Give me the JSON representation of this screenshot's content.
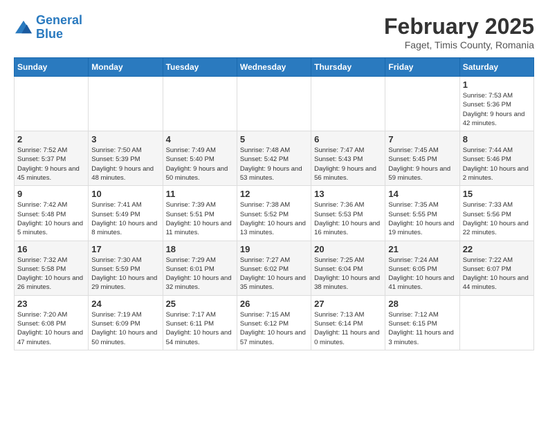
{
  "logo": {
    "line1": "General",
    "line2": "Blue"
  },
  "header": {
    "month": "February 2025",
    "location": "Faget, Timis County, Romania"
  },
  "weekdays": [
    "Sunday",
    "Monday",
    "Tuesday",
    "Wednesday",
    "Thursday",
    "Friday",
    "Saturday"
  ],
  "weeks": [
    [
      {
        "day": "",
        "info": ""
      },
      {
        "day": "",
        "info": ""
      },
      {
        "day": "",
        "info": ""
      },
      {
        "day": "",
        "info": ""
      },
      {
        "day": "",
        "info": ""
      },
      {
        "day": "",
        "info": ""
      },
      {
        "day": "1",
        "info": "Sunrise: 7:53 AM\nSunset: 5:36 PM\nDaylight: 9 hours and 42 minutes."
      }
    ],
    [
      {
        "day": "2",
        "info": "Sunrise: 7:52 AM\nSunset: 5:37 PM\nDaylight: 9 hours and 45 minutes."
      },
      {
        "day": "3",
        "info": "Sunrise: 7:50 AM\nSunset: 5:39 PM\nDaylight: 9 hours and 48 minutes."
      },
      {
        "day": "4",
        "info": "Sunrise: 7:49 AM\nSunset: 5:40 PM\nDaylight: 9 hours and 50 minutes."
      },
      {
        "day": "5",
        "info": "Sunrise: 7:48 AM\nSunset: 5:42 PM\nDaylight: 9 hours and 53 minutes."
      },
      {
        "day": "6",
        "info": "Sunrise: 7:47 AM\nSunset: 5:43 PM\nDaylight: 9 hours and 56 minutes."
      },
      {
        "day": "7",
        "info": "Sunrise: 7:45 AM\nSunset: 5:45 PM\nDaylight: 9 hours and 59 minutes."
      },
      {
        "day": "8",
        "info": "Sunrise: 7:44 AM\nSunset: 5:46 PM\nDaylight: 10 hours and 2 minutes."
      }
    ],
    [
      {
        "day": "9",
        "info": "Sunrise: 7:42 AM\nSunset: 5:48 PM\nDaylight: 10 hours and 5 minutes."
      },
      {
        "day": "10",
        "info": "Sunrise: 7:41 AM\nSunset: 5:49 PM\nDaylight: 10 hours and 8 minutes."
      },
      {
        "day": "11",
        "info": "Sunrise: 7:39 AM\nSunset: 5:51 PM\nDaylight: 10 hours and 11 minutes."
      },
      {
        "day": "12",
        "info": "Sunrise: 7:38 AM\nSunset: 5:52 PM\nDaylight: 10 hours and 13 minutes."
      },
      {
        "day": "13",
        "info": "Sunrise: 7:36 AM\nSunset: 5:53 PM\nDaylight: 10 hours and 16 minutes."
      },
      {
        "day": "14",
        "info": "Sunrise: 7:35 AM\nSunset: 5:55 PM\nDaylight: 10 hours and 19 minutes."
      },
      {
        "day": "15",
        "info": "Sunrise: 7:33 AM\nSunset: 5:56 PM\nDaylight: 10 hours and 22 minutes."
      }
    ],
    [
      {
        "day": "16",
        "info": "Sunrise: 7:32 AM\nSunset: 5:58 PM\nDaylight: 10 hours and 26 minutes."
      },
      {
        "day": "17",
        "info": "Sunrise: 7:30 AM\nSunset: 5:59 PM\nDaylight: 10 hours and 29 minutes."
      },
      {
        "day": "18",
        "info": "Sunrise: 7:29 AM\nSunset: 6:01 PM\nDaylight: 10 hours and 32 minutes."
      },
      {
        "day": "19",
        "info": "Sunrise: 7:27 AM\nSunset: 6:02 PM\nDaylight: 10 hours and 35 minutes."
      },
      {
        "day": "20",
        "info": "Sunrise: 7:25 AM\nSunset: 6:04 PM\nDaylight: 10 hours and 38 minutes."
      },
      {
        "day": "21",
        "info": "Sunrise: 7:24 AM\nSunset: 6:05 PM\nDaylight: 10 hours and 41 minutes."
      },
      {
        "day": "22",
        "info": "Sunrise: 7:22 AM\nSunset: 6:07 PM\nDaylight: 10 hours and 44 minutes."
      }
    ],
    [
      {
        "day": "23",
        "info": "Sunrise: 7:20 AM\nSunset: 6:08 PM\nDaylight: 10 hours and 47 minutes."
      },
      {
        "day": "24",
        "info": "Sunrise: 7:19 AM\nSunset: 6:09 PM\nDaylight: 10 hours and 50 minutes."
      },
      {
        "day": "25",
        "info": "Sunrise: 7:17 AM\nSunset: 6:11 PM\nDaylight: 10 hours and 54 minutes."
      },
      {
        "day": "26",
        "info": "Sunrise: 7:15 AM\nSunset: 6:12 PM\nDaylight: 10 hours and 57 minutes."
      },
      {
        "day": "27",
        "info": "Sunrise: 7:13 AM\nSunset: 6:14 PM\nDaylight: 11 hours and 0 minutes."
      },
      {
        "day": "28",
        "info": "Sunrise: 7:12 AM\nSunset: 6:15 PM\nDaylight: 11 hours and 3 minutes."
      },
      {
        "day": "",
        "info": ""
      }
    ]
  ]
}
